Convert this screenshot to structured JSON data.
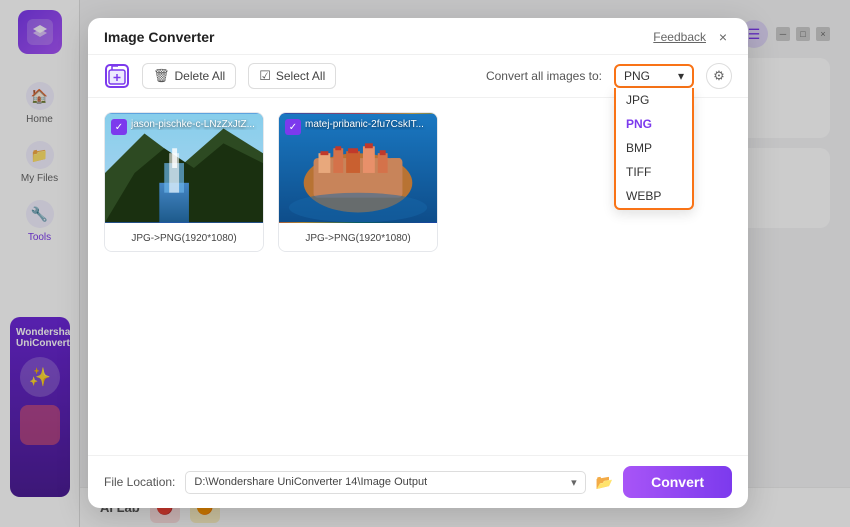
{
  "app": {
    "title": "Wondershare UniConverter",
    "short": "UniCon"
  },
  "sidebar": {
    "items": [
      {
        "label": "Home",
        "icon": "🏠"
      },
      {
        "label": "My Files",
        "icon": "📁"
      },
      {
        "label": "Tools",
        "icon": "🔧",
        "active": true
      }
    ]
  },
  "topbar": {
    "window_controls": [
      "─",
      "□",
      "×"
    ]
  },
  "modal": {
    "title": "Image Converter",
    "feedback_label": "Feedback",
    "close_label": "×",
    "toolbar": {
      "delete_all_label": "Delete All",
      "select_all_label": "Select All",
      "convert_all_label": "Convert all images to:"
    },
    "format_selector": {
      "selected": "PNG",
      "options": [
        "JPG",
        "PNG",
        "BMP",
        "TIFF",
        "WEBP"
      ]
    },
    "images": [
      {
        "filename": "jason-pischke-c-LNzZxJtZ...",
        "label": "JPG->PNG(1920*1080)",
        "type": "waterfall"
      },
      {
        "filename": "matej-pribanic-2fu7CskIT...",
        "label": "JPG->PNG(1920*1080)",
        "type": "aerial"
      }
    ],
    "footer": {
      "file_location_label": "File Location:",
      "file_location_value": "D:\\Wondershare UniConverter 14\\Image Output",
      "convert_button_label": "Convert"
    }
  },
  "ai_lab": {
    "label": "AI Lab",
    "icons": [
      "🔴",
      "🟠"
    ]
  }
}
